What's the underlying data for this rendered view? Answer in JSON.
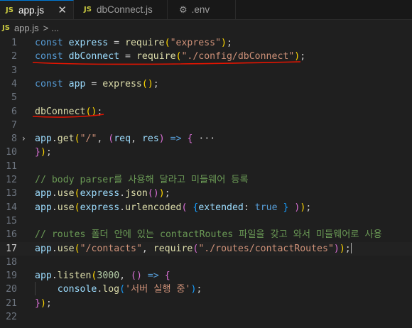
{
  "tabs": [
    {
      "label": "app.js",
      "icon": "js-file-icon",
      "icon_text": "JS",
      "active": true,
      "close": "✕"
    },
    {
      "label": "dbConnect.js",
      "icon": "js-file-icon",
      "icon_text": "JS",
      "active": false
    },
    {
      "label": ".env",
      "icon": "gear-icon",
      "icon_text": "⚙",
      "active": false
    }
  ],
  "breadcrumb": {
    "icon_text": "JS",
    "file": "app.js",
    "separator": ">",
    "rest": "..."
  },
  "colors": {
    "keyword": "#569cd6",
    "variable": "#9cdcfe",
    "function": "#dcdcaa",
    "string": "#ce9178",
    "comment": "#6a9955",
    "punct": "#cccccc",
    "bracket1": "#ffd700",
    "bracket2": "#da70d6",
    "bracket3": "#179fff",
    "annotation": "#e51400"
  },
  "lines": [
    {
      "n": "1",
      "tokens": [
        [
          "const ",
          "keyword"
        ],
        [
          "express",
          "variable"
        ],
        [
          " = ",
          "punct"
        ],
        [
          "require",
          "function"
        ],
        [
          "(",
          "bracket1"
        ],
        [
          "\"express\"",
          "string"
        ],
        [
          ")",
          "bracket1"
        ],
        [
          ";",
          "punct"
        ]
      ]
    },
    {
      "n": "2",
      "tokens": [
        [
          "const ",
          "keyword"
        ],
        [
          "dbConnect",
          "variable"
        ],
        [
          " = ",
          "punct"
        ],
        [
          "require",
          "function"
        ],
        [
          "(",
          "bracket1"
        ],
        [
          "\"./config/dbConnect\"",
          "string"
        ],
        [
          ")",
          "bracket1"
        ],
        [
          ";",
          "punct"
        ]
      ]
    },
    {
      "n": "3",
      "tokens": []
    },
    {
      "n": "4",
      "tokens": [
        [
          "const ",
          "keyword"
        ],
        [
          "app",
          "variable"
        ],
        [
          " = ",
          "punct"
        ],
        [
          "express",
          "function"
        ],
        [
          "()",
          "bracket1"
        ],
        [
          ";",
          "punct"
        ]
      ]
    },
    {
      "n": "5",
      "tokens": []
    },
    {
      "n": "6",
      "tokens": [
        [
          "dbConnect",
          "function"
        ],
        [
          "()",
          "bracket1"
        ],
        [
          ";",
          "punct"
        ]
      ]
    },
    {
      "n": "7",
      "tokens": []
    },
    {
      "n": "8",
      "fold": "›",
      "tokens": [
        [
          "app",
          "variable"
        ],
        [
          ".",
          "punct"
        ],
        [
          "get",
          "function"
        ],
        [
          "(",
          "bracket1"
        ],
        [
          "\"/\"",
          "string"
        ],
        [
          ", ",
          "punct"
        ],
        [
          "(",
          "bracket2"
        ],
        [
          "req",
          "variable"
        ],
        [
          ", ",
          "punct"
        ],
        [
          "res",
          "variable"
        ],
        [
          ")",
          "bracket2"
        ],
        [
          " => ",
          "keyword"
        ],
        [
          "{",
          "bracket2"
        ],
        [
          " ···",
          "punct"
        ]
      ]
    },
    {
      "n": "10",
      "tokens": [
        [
          "}",
          "bracket2"
        ],
        [
          ")",
          "bracket1"
        ],
        [
          ";",
          "punct"
        ]
      ]
    },
    {
      "n": "11",
      "tokens": []
    },
    {
      "n": "12",
      "tokens": [
        [
          "// body parser를 사용해 달라고 미들웨어 등록",
          "comment"
        ]
      ]
    },
    {
      "n": "13",
      "tokens": [
        [
          "app",
          "variable"
        ],
        [
          ".",
          "punct"
        ],
        [
          "use",
          "function"
        ],
        [
          "(",
          "bracket1"
        ],
        [
          "express",
          "variable"
        ],
        [
          ".",
          "punct"
        ],
        [
          "json",
          "function"
        ],
        [
          "()",
          "bracket2"
        ],
        [
          ")",
          "bracket1"
        ],
        [
          ";",
          "punct"
        ]
      ]
    },
    {
      "n": "14",
      "tokens": [
        [
          "app",
          "variable"
        ],
        [
          ".",
          "punct"
        ],
        [
          "use",
          "function"
        ],
        [
          "(",
          "bracket1"
        ],
        [
          "express",
          "variable"
        ],
        [
          ".",
          "punct"
        ],
        [
          "urlencoded",
          "function"
        ],
        [
          "(",
          "bracket2"
        ],
        [
          " ",
          "punct"
        ],
        [
          "{",
          "bracket3"
        ],
        [
          "extended",
          "variable"
        ],
        [
          ": ",
          "punct"
        ],
        [
          "true",
          "keyword"
        ],
        [
          " ",
          "punct"
        ],
        [
          "}",
          "bracket3"
        ],
        [
          " ",
          "punct"
        ],
        [
          ")",
          "bracket2"
        ],
        [
          ")",
          "bracket1"
        ],
        [
          ";",
          "punct"
        ]
      ]
    },
    {
      "n": "15",
      "tokens": []
    },
    {
      "n": "16",
      "tokens": [
        [
          "// routes 폴더 안에 있는 contactRoutes 파일을 갖고 와서 미들웨어로 사용",
          "comment"
        ]
      ]
    },
    {
      "n": "17",
      "active": true,
      "tokens": [
        [
          "app",
          "variable"
        ],
        [
          ".",
          "punct"
        ],
        [
          "use",
          "function"
        ],
        [
          "(",
          "bracket1"
        ],
        [
          "\"/contacts\"",
          "string"
        ],
        [
          ", ",
          "punct"
        ],
        [
          "require",
          "function"
        ],
        [
          "(",
          "bracket2"
        ],
        [
          "\"./routes/contactRoutes\"",
          "string"
        ],
        [
          ")",
          "bracket2"
        ],
        [
          ")",
          "bracket1"
        ],
        [
          ";",
          "punct"
        ]
      ]
    },
    {
      "n": "18",
      "tokens": []
    },
    {
      "n": "19",
      "tokens": [
        [
          "app",
          "variable"
        ],
        [
          ".",
          "punct"
        ],
        [
          "listen",
          "function"
        ],
        [
          "(",
          "bracket1"
        ],
        [
          "3000",
          "number"
        ],
        [
          ", ",
          "punct"
        ],
        [
          "()",
          "bracket2"
        ],
        [
          " => ",
          "keyword"
        ],
        [
          "{",
          "bracket2"
        ]
      ]
    },
    {
      "n": "20",
      "tokens": [
        [
          "    console",
          "variable"
        ],
        [
          ".",
          "punct"
        ],
        [
          "log",
          "function"
        ],
        [
          "(",
          "bracket3"
        ],
        [
          "'서버 실행 중'",
          "string"
        ],
        [
          ")",
          "bracket3"
        ],
        [
          ";",
          "punct"
        ]
      ]
    },
    {
      "n": "21",
      "tokens": [
        [
          "}",
          "bracket2"
        ],
        [
          ")",
          "bracket1"
        ],
        [
          ";",
          "punct"
        ]
      ]
    },
    {
      "n": "22",
      "tokens": []
    }
  ]
}
